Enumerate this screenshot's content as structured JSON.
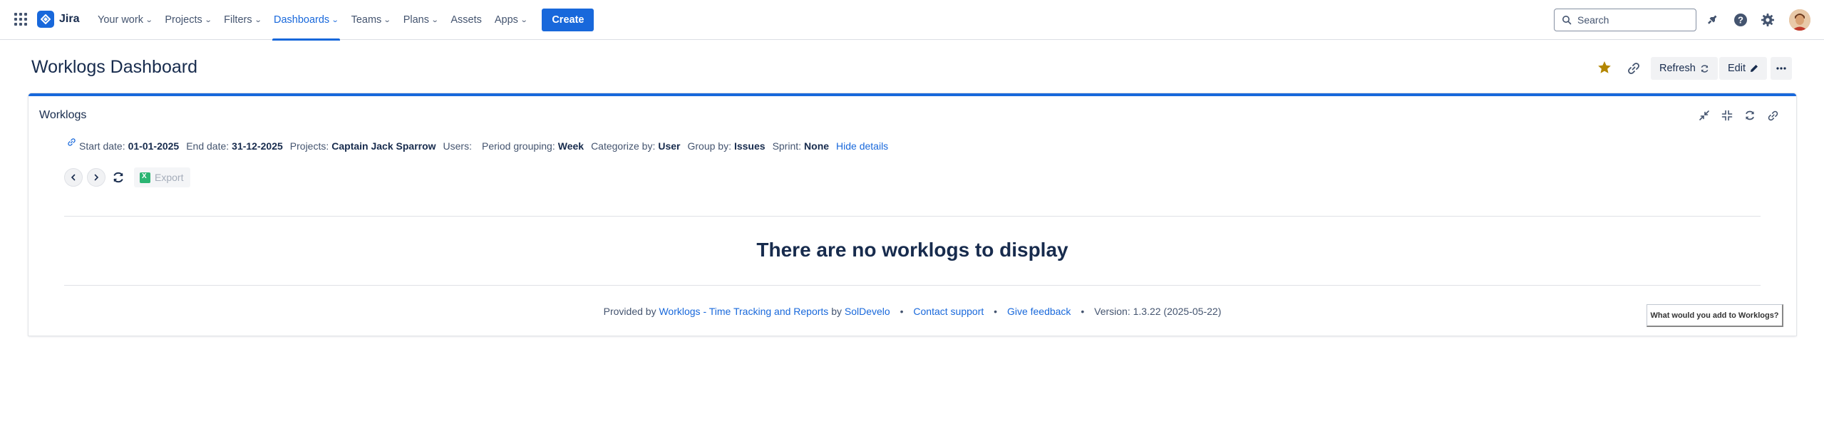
{
  "nav": {
    "logo_text": "Jira",
    "items": [
      {
        "label": "Your work"
      },
      {
        "label": "Projects"
      },
      {
        "label": "Filters"
      },
      {
        "label": "Dashboards"
      },
      {
        "label": "Teams"
      },
      {
        "label": "Plans"
      },
      {
        "label": "Assets"
      },
      {
        "label": "Apps"
      }
    ],
    "active_item": "Dashboards",
    "create_label": "Create",
    "search_placeholder": "Search",
    "accent_color": "#1868db"
  },
  "page": {
    "title": "Worklogs Dashboard",
    "refresh_label": "Refresh",
    "edit_label": "Edit",
    "starred": true
  },
  "gadget": {
    "title": "Worklogs",
    "filters": {
      "start_label": "Start date:",
      "start_value": "01-01-2025",
      "end_label": "End date:",
      "end_value": "31-12-2025",
      "projects_label": "Projects:",
      "projects_value": "Captain Jack Sparrow",
      "users_label": "Users:",
      "period_label": "Period grouping:",
      "period_value": "Week",
      "categorize_label": "Categorize by:",
      "categorize_value": "User",
      "group_label": "Group by:",
      "group_value": "Issues",
      "sprint_label": "Sprint:",
      "sprint_value": "None",
      "hide_details": "Hide details"
    },
    "export_label": "Export",
    "empty_message": "There are no worklogs to display",
    "footer": {
      "provided_by": "Provided by",
      "app_link": "Worklogs - Time Tracking and Reports",
      "by": "by",
      "vendor_link": "SolDevelo",
      "contact": "Contact support",
      "feedback": "Give feedback",
      "version": "Version: 1.3.22 (2025-05-22)"
    },
    "feedback_button": "What would you add to Worklogs?"
  }
}
